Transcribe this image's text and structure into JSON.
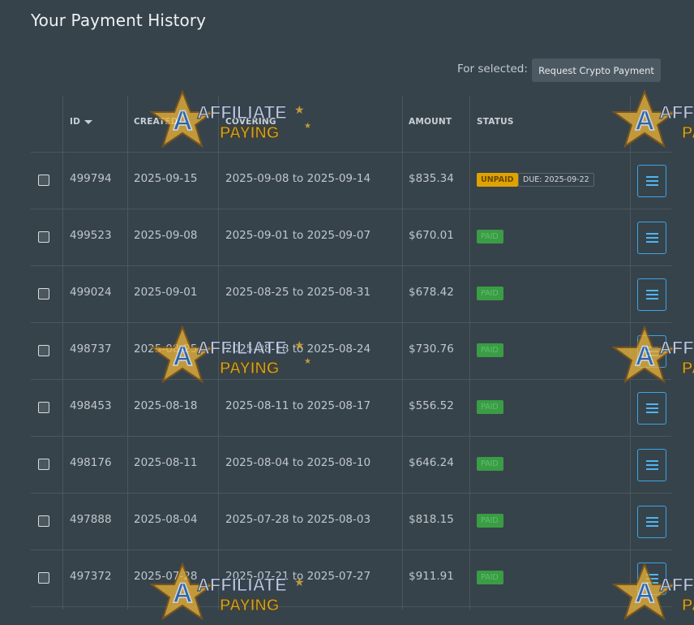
{
  "page": {
    "title": "Your Payment History"
  },
  "toolbar": {
    "for_selected_label": "For selected:",
    "crypto_button_label": "Request Crypto Payment"
  },
  "table": {
    "headers": {
      "id": "ID",
      "created": "CREATED",
      "covering": "COVERING",
      "amount": "AMOUNT",
      "status": "STATUS"
    },
    "sort": {
      "column": "ID",
      "direction": "descending"
    },
    "rows": [
      {
        "id": "499794",
        "created": "2025-09-15",
        "covering": "2025-09-08 to 2025-09-14",
        "amount": "$835.34",
        "status": "UNPAID",
        "due": "DUE: 2025-09-22"
      },
      {
        "id": "499523",
        "created": "2025-09-08",
        "covering": "2025-09-01 to 2025-09-07",
        "amount": "$670.01",
        "status": "PAID"
      },
      {
        "id": "499024",
        "created": "2025-09-01",
        "covering": "2025-08-25 to 2025-08-31",
        "amount": "$678.42",
        "status": "PAID"
      },
      {
        "id": "498737",
        "created": "2025-08-25",
        "covering": "2025-08-18 to 2025-08-24",
        "amount": "$730.76",
        "status": "PAID"
      },
      {
        "id": "498453",
        "created": "2025-08-18",
        "covering": "2025-08-11 to 2025-08-17",
        "amount": "$556.52",
        "status": "PAID"
      },
      {
        "id": "498176",
        "created": "2025-08-11",
        "covering": "2025-08-04 to 2025-08-10",
        "amount": "$646.24",
        "status": "PAID"
      },
      {
        "id": "497888",
        "created": "2025-08-04",
        "covering": "2025-07-28 to 2025-08-03",
        "amount": "$818.15",
        "status": "PAID"
      },
      {
        "id": "497372",
        "created": "2025-07-28",
        "covering": "2025-07-21 to 2025-07-27",
        "amount": "$911.91",
        "status": "PAID"
      }
    ]
  },
  "watermark": {
    "line1": "AFFILIATE",
    "line2": "PAYING",
    "icon": "star-logo-icon"
  },
  "colors": {
    "background": "#37434b",
    "unpaid": "#e0a200",
    "paid": "#3a9c45",
    "accent": "#3aa5e6"
  }
}
